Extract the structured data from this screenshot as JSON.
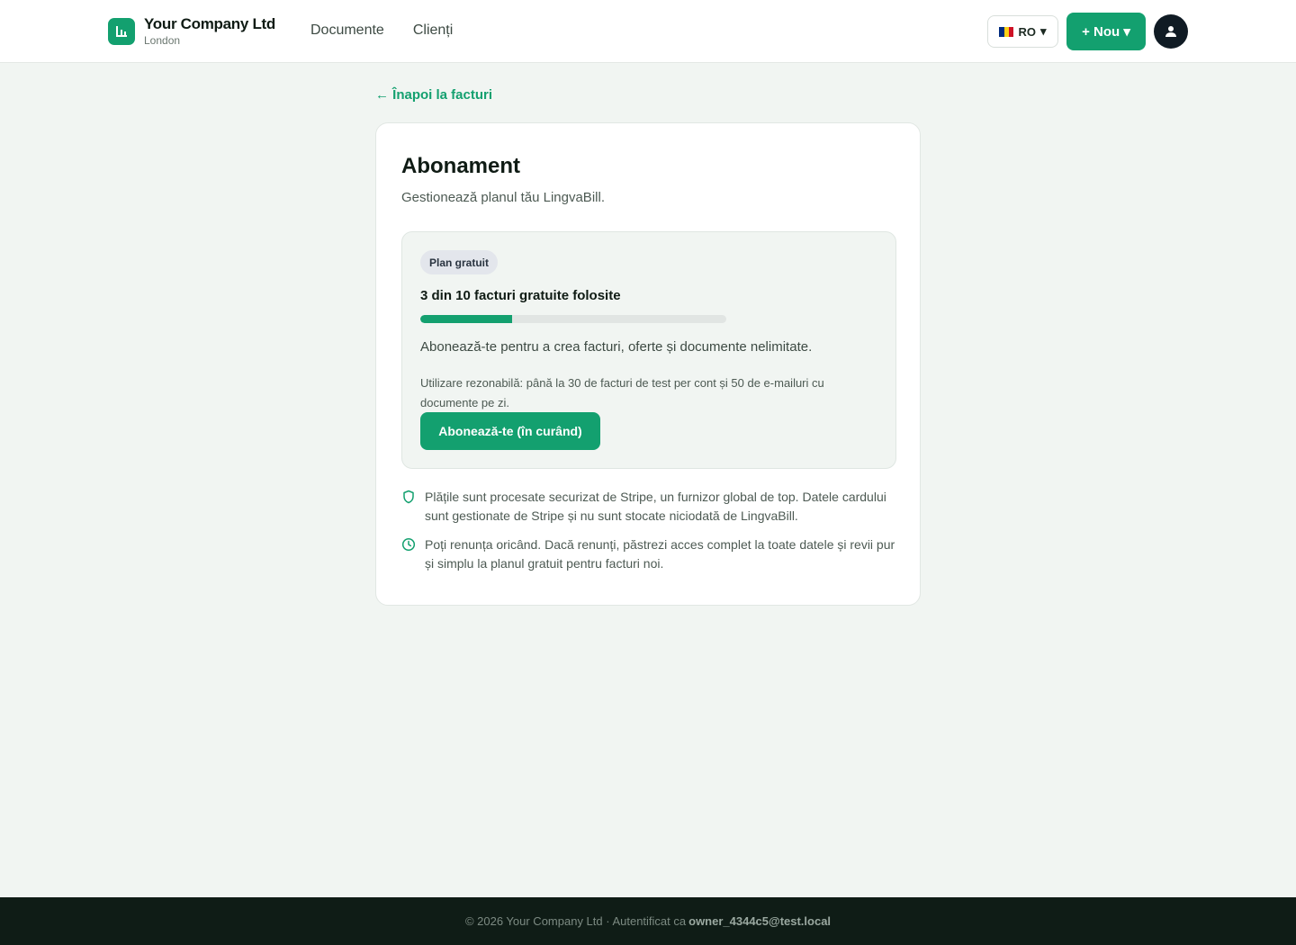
{
  "header": {
    "company_name": "Your Company Ltd",
    "company_city": "London",
    "nav": [
      "Documente",
      "Clienți"
    ],
    "language": "RO",
    "new_button": "+ Nou ▾"
  },
  "back_link": "← Înapoi la facturi",
  "subscription": {
    "title": "Abonament",
    "subtitle": "Gestionează planul tău LingvaBill.",
    "plan_badge": "Plan gratuit",
    "usage_text": "3 din 10 facturi gratuite folosite",
    "usage_used": 3,
    "usage_total": 10,
    "pitch": "Abonează-te pentru a crea facturi, oferte și documente nelimitate.",
    "fair_use": "Utilizare rezonabilă: până la 30 de facturi de test per cont și 50 de e-mailuri cu documente pe zi.",
    "subscribe_button": "Abonează-te (în curând)"
  },
  "info": [
    {
      "icon": "shield-icon",
      "text": "Plățile sunt procesate securizat de Stripe, un furnizor global de top. Datele cardului sunt gestionate de Stripe și nu sunt stocate niciodată de LingvaBill."
    },
    {
      "icon": "clock-icon",
      "text": "Poți renunța oricând. Dacă renunți, păstrezi acces complet la toate datele și revii pur și simplu la planul gratuit pentru facturi noi."
    }
  ],
  "footer": {
    "text": "© 2026 Your Company Ltd · Autentificat ca",
    "email": "owner_4344c5@test.local"
  },
  "colors": {
    "accent": "#13a06f",
    "background": "#f1f5f2",
    "footer": "#0f1c16"
  }
}
